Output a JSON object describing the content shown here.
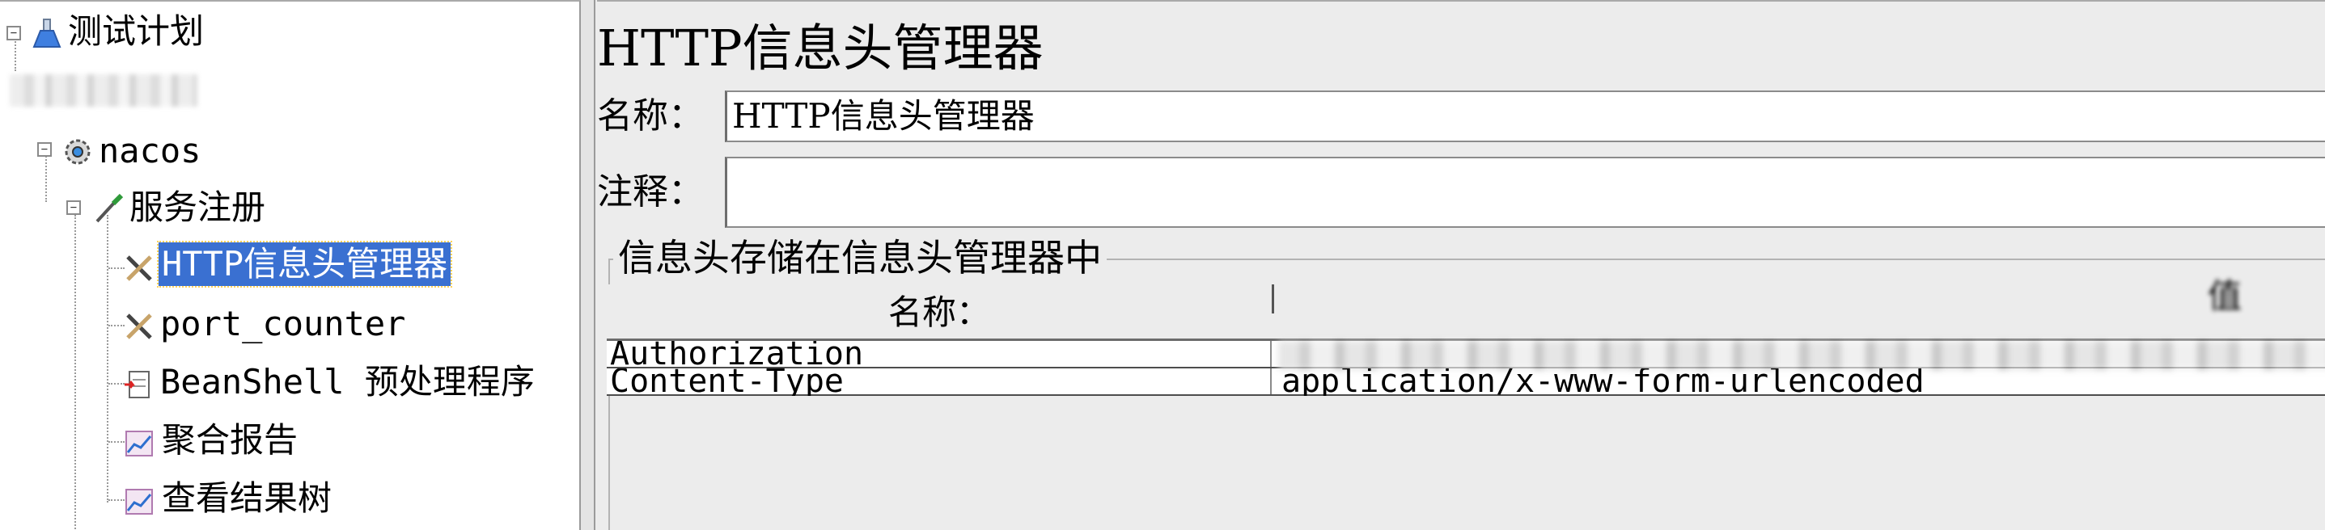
{
  "tree": {
    "items": [
      {
        "label": "测试计划",
        "icon": "flask-icon"
      },
      {
        "label": "",
        "icon": "redacted"
      },
      {
        "label": "nacos",
        "icon": "gear-icon"
      },
      {
        "label": "服务注册",
        "icon": "pipette-icon"
      },
      {
        "label": "HTTP信息头管理器",
        "icon": "wrench-tools-icon",
        "selected": true
      },
      {
        "label": "port_counter",
        "icon": "wrench-tools-icon"
      },
      {
        "label": "BeanShell 预处理程序",
        "icon": "script-icon"
      },
      {
        "label": "聚合报告",
        "icon": "chart-icon"
      },
      {
        "label": "查看结果树",
        "icon": "chart-icon"
      }
    ]
  },
  "editor": {
    "title": "HTTP信息头管理器",
    "name_label": "名称：",
    "name_value": "HTTP信息头管理器",
    "comment_label": "注释：",
    "comment_value": "",
    "group_title": "信息头存储在信息头管理器中"
  },
  "headers_table": {
    "columns": [
      "名称：",
      "值"
    ],
    "rows": [
      {
        "name": "Authorization",
        "value": ""
      },
      {
        "name": "Content-Type",
        "value": "application/x-www-form-urlencoded"
      }
    ]
  },
  "colors": {
    "selection": "#3a70d1",
    "panel_bg": "#ececec"
  }
}
